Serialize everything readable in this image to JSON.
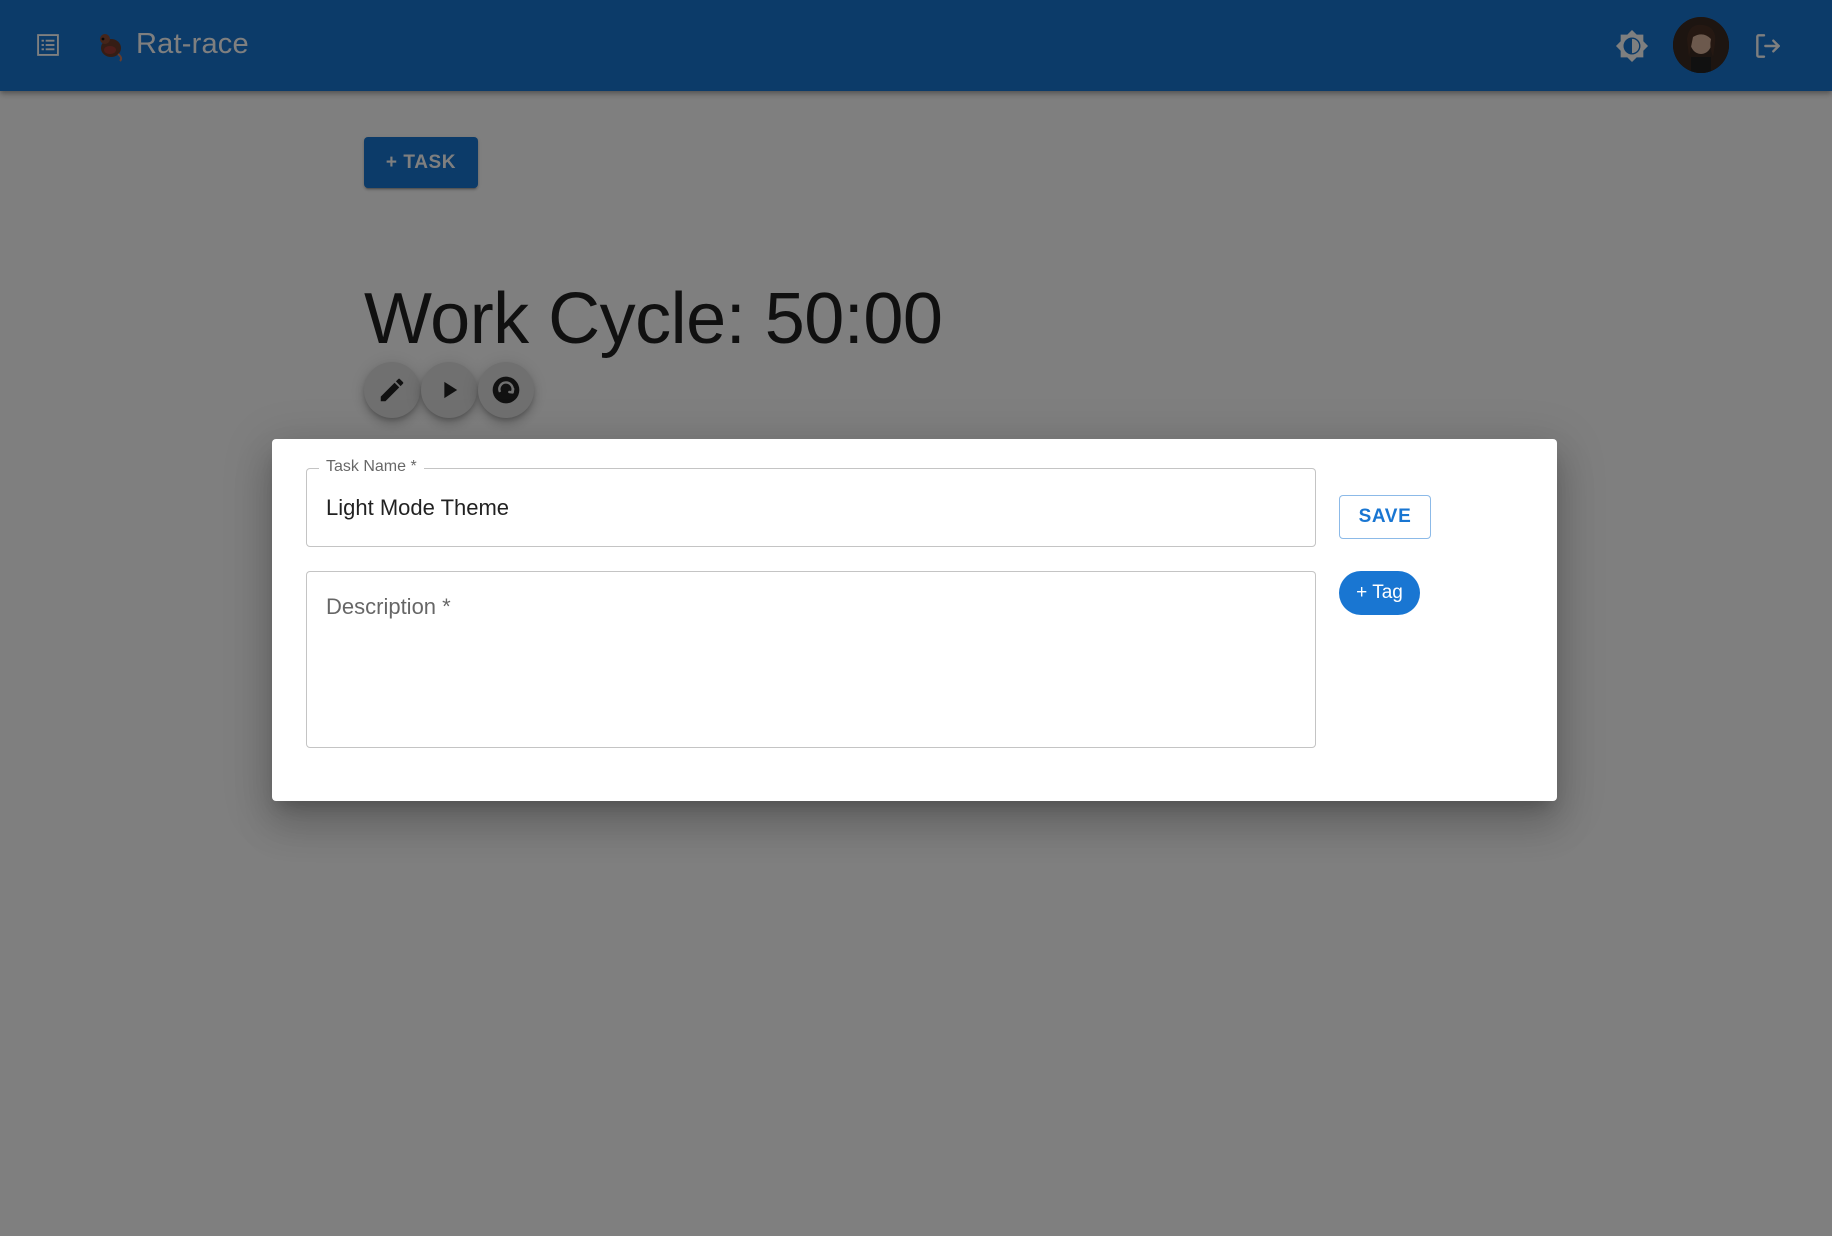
{
  "appbar": {
    "title": "Rat-race",
    "icons": {
      "menu": "list-icon",
      "logo": "rat-logo-icon",
      "theme": "brightness-icon",
      "avatar": "user-avatar",
      "logout": "logout-icon"
    }
  },
  "main": {
    "add_task_label": "+ TASK",
    "cycle_heading": "Work Cycle: 50:00",
    "controls": {
      "edit": "pencil-icon",
      "play": "play-icon",
      "reset": "reset-icon"
    }
  },
  "dialog": {
    "task_name": {
      "label": "Task Name *",
      "value": "Light Mode Theme"
    },
    "description": {
      "placeholder": "Description *",
      "value": ""
    },
    "save_label": "SAVE",
    "tag_label": "+ Tag"
  },
  "colors": {
    "primary": "#1976d2",
    "backdrop": "rgba(0,0,0,0.5)",
    "fab_background": "#e0e0e0"
  }
}
